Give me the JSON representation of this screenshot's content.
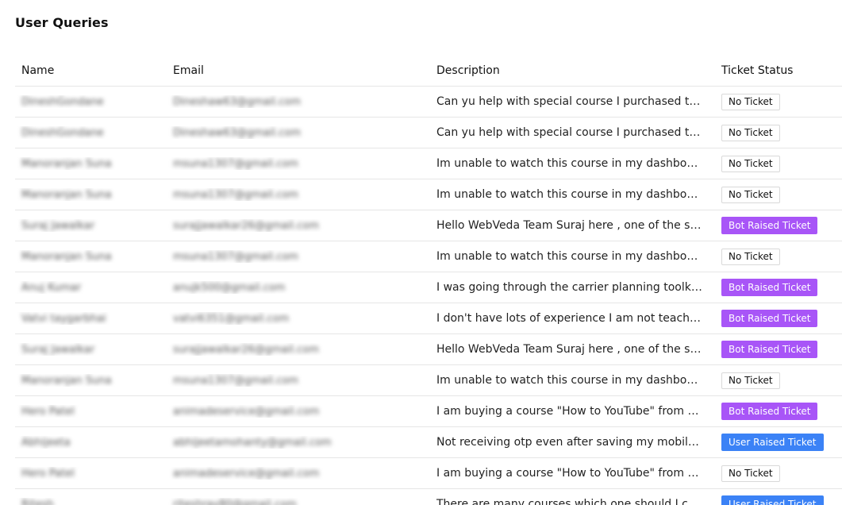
{
  "page": {
    "title": "User Queries"
  },
  "colors": {
    "bot_badge": "#a855f7",
    "user_badge": "#3b82f6",
    "no_ticket_border": "#d9d9d9",
    "row_divider": "#e6e6e6"
  },
  "table": {
    "columns": [
      "Name",
      "Email",
      "Description",
      "Ticket Status"
    ],
    "rows": [
      {
        "name": "DineshGondane",
        "email": "Dineshaw63@gmail.com",
        "description": "Can yu help with special course I purchased today, it is not visible",
        "status": "No Ticket",
        "status_type": "none"
      },
      {
        "name": "DineshGondane",
        "email": "Dineshaw63@gmail.com",
        "description": "Can yu help with special course I purchased today, it is not visible",
        "status": "No Ticket",
        "status_type": "none"
      },
      {
        "name": "Manoranjan Suna",
        "email": "msuna1307@gmail.com",
        "description": "Im unable to watch this course in my dashboard",
        "status": "No Ticket",
        "status_type": "none"
      },
      {
        "name": "Manoranjan Suna",
        "email": "msuna1307@gmail.com",
        "description": "Im unable to watch this course in my dashboard",
        "status": "No Ticket",
        "status_type": "none"
      },
      {
        "name": "Suraj Jawalkar",
        "email": "surajjawalkar26@gmail.com",
        "description": "Hello WebVeda Team Suraj here , one of the students of yours",
        "status": "Bot Raised Ticket",
        "status_type": "bot"
      },
      {
        "name": "Manoranjan Suna",
        "email": "msuna1307@gmail.com",
        "description": "Im unable to watch this course in my dashboard",
        "status": "No Ticket",
        "status_type": "none"
      },
      {
        "name": "Anuj Kumar",
        "email": "anujk500@gmail.com",
        "description": "I was going through the carrier planning toolkit course content",
        "status": "Bot Raised Ticket",
        "status_type": "bot"
      },
      {
        "name": "Vatvi taygarbhai",
        "email": "vatvi6351@gmail.com",
        "description": "I don't have lots of experience I am not teacher here",
        "status": "Bot Raised Ticket",
        "status_type": "bot"
      },
      {
        "name": "Suraj Jawalkar",
        "email": "surajjawalkar26@gmail.com",
        "description": "Hello WebVeda Team Suraj here , one of the students of yours",
        "status": "Bot Raised Ticket",
        "status_type": "bot"
      },
      {
        "name": "Manoranjan Suna",
        "email": "msuna1307@gmail.com",
        "description": "Im unable to watch this course in my dashboard",
        "status": "No Ticket",
        "status_type": "none"
      },
      {
        "name": "Hero Patel",
        "email": "animadeservice@gmail.com",
        "description": "I am buying a course \"How to YouTube\" from your website",
        "status": "Bot Raised Ticket",
        "status_type": "bot"
      },
      {
        "name": "Abhijeeta",
        "email": "abhijeetamohanty@gmail.com",
        "description": "Not receiving otp even after saving my mobile number",
        "status": "User Raised Ticket",
        "status_type": "user"
      },
      {
        "name": "Hero Patel",
        "email": "animadeservice@gmail.com",
        "description": "I am buying a course \"How to YouTube\" from your website",
        "status": "No Ticket",
        "status_type": "none"
      },
      {
        "name": "Ritesh",
        "email": "riteshrav80@gmail.com",
        "description": "There are many courses which one should I choose for me",
        "status": "User Raised Ticket",
        "status_type": "user"
      }
    ]
  }
}
